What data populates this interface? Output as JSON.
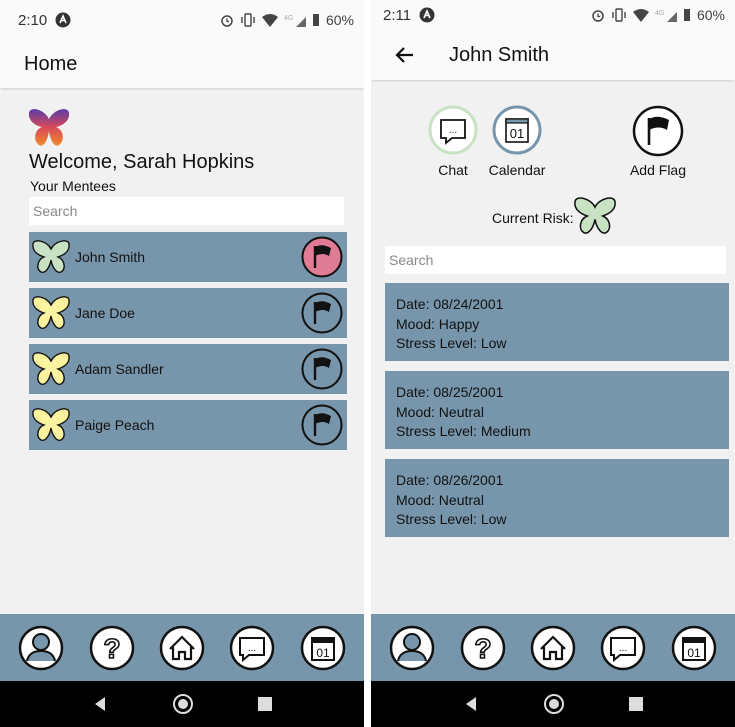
{
  "left": {
    "status": {
      "time": "2:10",
      "battery": "60%"
    },
    "title": "Home",
    "welcome": "Welcome, Sarah Hopkins",
    "subtitle": "Your Mentees",
    "search_placeholder": "Search",
    "mentees": [
      {
        "name": "John Smith",
        "butterfly_color": "#c9e2c4",
        "flag_color": "#e07b95"
      },
      {
        "name": "Jane Doe",
        "butterfly_color": "#fbf3a0",
        "flag_color": "#7896ab"
      },
      {
        "name": "Adam Sandler",
        "butterfly_color": "#fbf3a0",
        "flag_color": "#7896ab"
      },
      {
        "name": "Paige Peach",
        "butterfly_color": "#fbf3a0",
        "flag_color": "#7896ab"
      }
    ]
  },
  "right": {
    "status": {
      "time": "2:11",
      "battery": "60%"
    },
    "title": "John Smith",
    "actions": {
      "chat": "Chat",
      "calendar": "Calendar",
      "calendar_day": "01",
      "add_flag": "Add Flag"
    },
    "current_risk_label": "Current Risk:",
    "search_placeholder": "Search",
    "entries": [
      {
        "date": "Date: 08/24/2001",
        "mood": "Mood: Happy",
        "stress": "Stress Level: Low"
      },
      {
        "date": "Date: 08/25/2001",
        "mood": "Mood: Neutral",
        "stress": "Stress Level: Medium"
      },
      {
        "date": "Date: 08/26/2001",
        "mood": "Mood: Neutral",
        "stress": "Stress Level: Low"
      }
    ]
  },
  "bottom_nav": {
    "items": [
      "profile-icon",
      "help-icon",
      "home-icon",
      "chat-icon",
      "calendar-icon"
    ],
    "calendar_day": "01"
  },
  "colors": {
    "accent": "#7896ab",
    "risk_low": "#c9e2c4",
    "risk_med": "#fbf3a0",
    "flagged": "#e07b95"
  }
}
